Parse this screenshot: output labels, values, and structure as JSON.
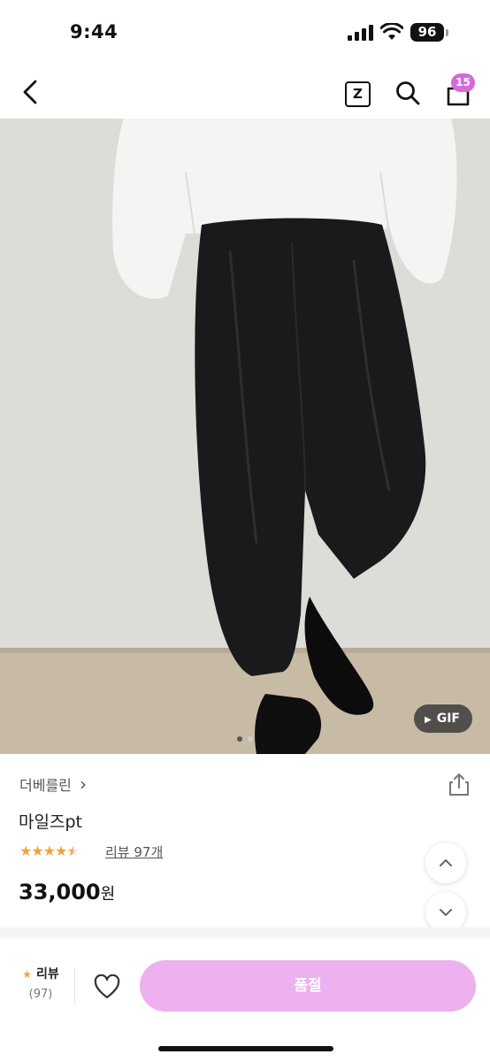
{
  "status_bar": {
    "time": "9:44",
    "battery_level": "96",
    "icons": [
      "signal-icon",
      "wifi-icon",
      "battery-icon"
    ]
  },
  "nav": {
    "icons": [
      "back-icon",
      "zigzag-icon",
      "search-icon",
      "shopping-bag-icon"
    ],
    "z_label": "Z",
    "cart_count": "15",
    "badge_color": "#d36bdc"
  },
  "gallery": {
    "gif_label": "GIF",
    "current_image": 1,
    "image_count": 2
  },
  "product": {
    "brand": "더베를린",
    "brand_chevron": "›",
    "name": "마일즈pt",
    "rating": 4.5,
    "review_label": "리뷰 97개",
    "price": "33,000",
    "price_unit": "원"
  },
  "bottom_bar": {
    "review_label": "리뷰",
    "review_count": "(97)",
    "soldout_label": "품절",
    "button_color": "#ecb1ee"
  },
  "colors": {
    "accent": "#d36bdc",
    "star": "#f2a33a"
  }
}
